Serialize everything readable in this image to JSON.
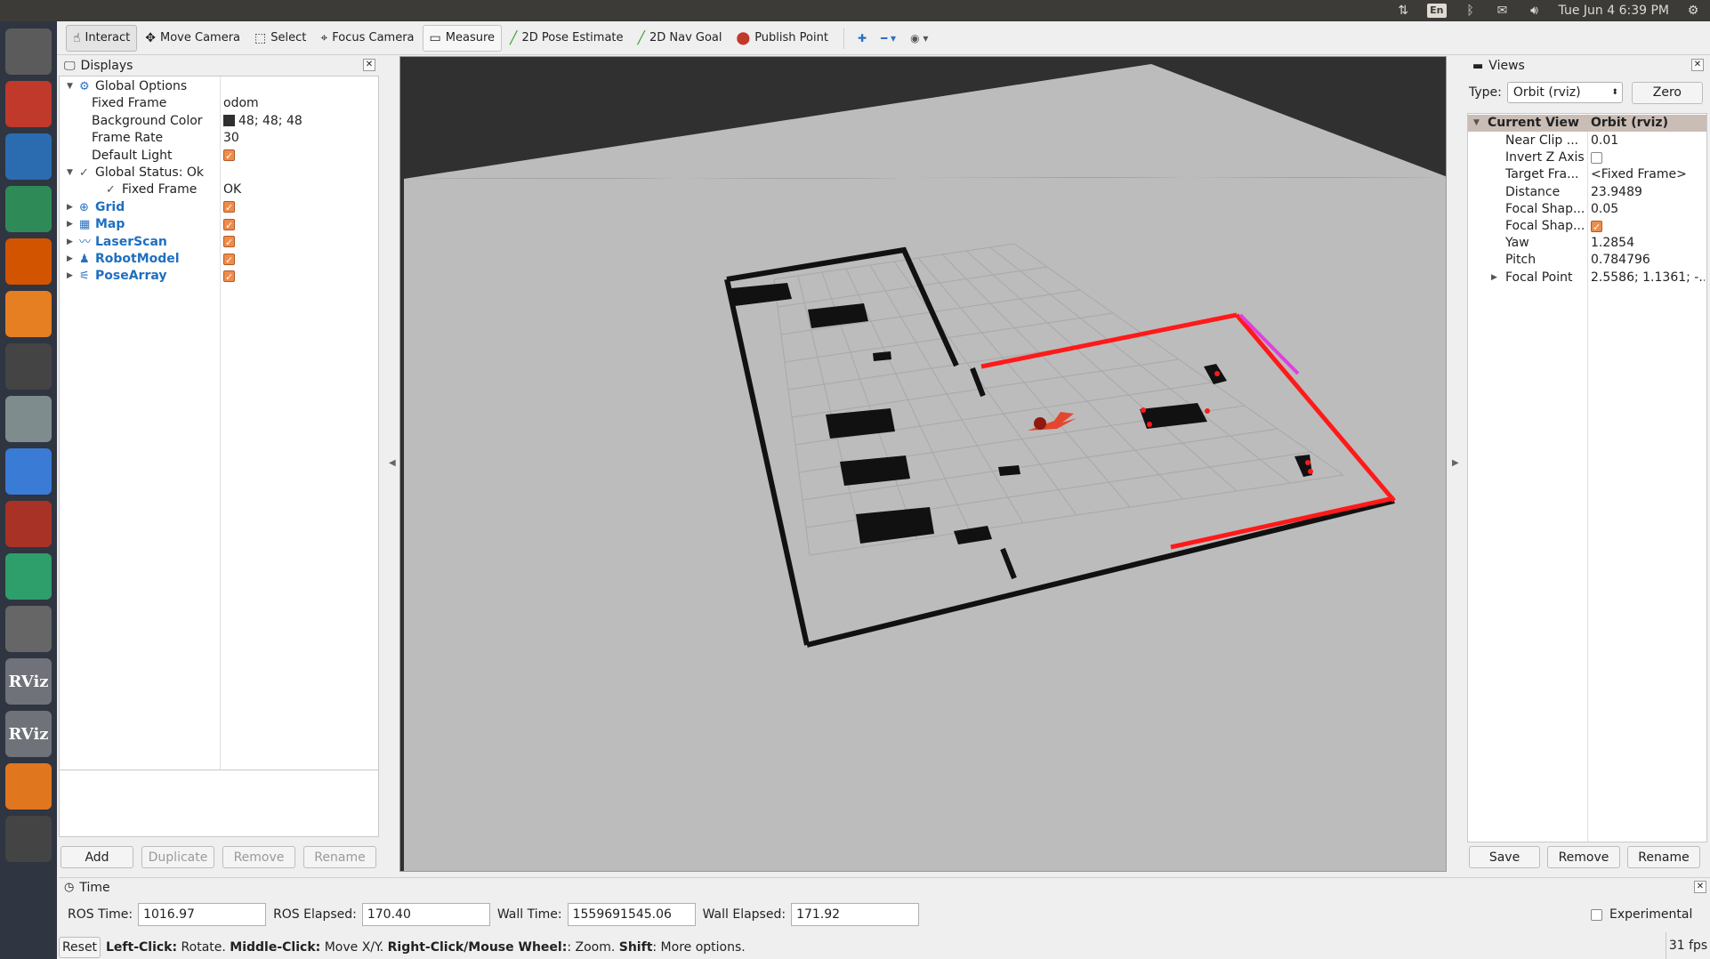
{
  "topbar": {
    "keyboard_layout": "En",
    "clock": "Tue Jun  4  6:39 PM",
    "icons": [
      "network-icon",
      "keyboard-icon",
      "bluetooth-icon",
      "mail-icon",
      "volume-icon",
      "settings-gear-icon"
    ]
  },
  "launcher": {
    "items": [
      {
        "name": "ubuntu-dash-icon",
        "color": "#5b5b5b"
      },
      {
        "name": "files-icon",
        "color": "#c0392b"
      },
      {
        "name": "writer-icon",
        "color": "#2b6cb0"
      },
      {
        "name": "calc-icon",
        "color": "#2e8b57"
      },
      {
        "name": "impress-icon",
        "color": "#d35400"
      },
      {
        "name": "software-center-icon",
        "color": "#e67e22"
      },
      {
        "name": "amazon-icon",
        "color": "#444444"
      },
      {
        "name": "system-settings-icon",
        "color": "#7f8c8d"
      },
      {
        "name": "chrome-icon",
        "color": "#3a7bd5"
      },
      {
        "name": "terminal-red-icon",
        "color": "#a93226"
      },
      {
        "name": "atom-icon",
        "color": "#2e9e6b"
      },
      {
        "name": "calculator-icon",
        "color": "#666666"
      },
      {
        "name": "rviz-icon",
        "color": "#6f7279",
        "text": "RViz"
      },
      {
        "name": "rviz-icon-2",
        "color": "#6f7279",
        "text": "RViz"
      },
      {
        "name": "sublime-icon",
        "color": "#e0771f"
      },
      {
        "name": "trash-icon",
        "color": "#444444"
      }
    ]
  },
  "toolbar": {
    "tools": [
      {
        "label": "Interact",
        "icon": "☝",
        "active": true
      },
      {
        "label": "Move Camera",
        "icon": "✥"
      },
      {
        "label": "Select",
        "icon": "⬚"
      },
      {
        "label": "Focus Camera",
        "icon": "⌖"
      },
      {
        "label": "Measure",
        "icon": "▭",
        "bordered": true
      },
      {
        "label": "2D Pose Estimate",
        "icon": "╱",
        "iconColor": "#2ca02c"
      },
      {
        "label": "2D Nav Goal",
        "icon": "╱",
        "iconColor": "#2ca02c"
      },
      {
        "label": "Publish Point",
        "icon": "⬤",
        "iconColor": "#c0392b"
      }
    ],
    "extra_icons": [
      "add-tool-icon",
      "remove-tool-icon",
      "view-options-icon"
    ]
  },
  "displays": {
    "title": "Displays",
    "rows": [
      {
        "indent": 0,
        "arrow": "▼",
        "icon": "⚙",
        "name": "Global Options",
        "value": ""
      },
      {
        "indent": 1,
        "name": "Fixed Frame",
        "value": "odom"
      },
      {
        "indent": 1,
        "name": "Background Color",
        "value": "48; 48; 48",
        "swatch": true
      },
      {
        "indent": 1,
        "name": "Frame Rate",
        "value": "30"
      },
      {
        "indent": 1,
        "name": "Default Light",
        "checkbox": true
      },
      {
        "indent": 0,
        "arrow": "▼",
        "check": true,
        "name": "Global Status: Ok",
        "value": ""
      },
      {
        "indent": 2,
        "check": true,
        "name": "Fixed Frame",
        "value": "OK"
      },
      {
        "indent": 0,
        "arrow": "▶",
        "icon": "⊕",
        "name": "Grid",
        "blue": true,
        "checkbox": true
      },
      {
        "indent": 0,
        "arrow": "▶",
        "icon": "▦",
        "name": "Map",
        "blue": true,
        "checkbox": true
      },
      {
        "indent": 0,
        "arrow": "▶",
        "icon": "〰",
        "name": "LaserScan",
        "blue": true,
        "checkbox": true
      },
      {
        "indent": 0,
        "arrow": "▶",
        "icon": "♟",
        "name": "RobotModel",
        "blue": true,
        "checkbox": true
      },
      {
        "indent": 0,
        "arrow": "▶",
        "icon": "⚟",
        "name": "PoseArray",
        "blue": true,
        "checkbox": true
      }
    ],
    "buttons": {
      "add": "Add",
      "duplicate": "Duplicate",
      "remove": "Remove",
      "rename": "Rename"
    }
  },
  "views": {
    "title": "Views",
    "type_label": "Type:",
    "type_value": "Orbit (rviz)",
    "zero_label": "Zero",
    "header": {
      "name": "Current View",
      "value": "Orbit (rviz)"
    },
    "rows": [
      {
        "name": "Near Clip ...",
        "value": "0.01"
      },
      {
        "name": "Invert Z Axis",
        "checkbox": false
      },
      {
        "name": "Target Fra...",
        "value": "<Fixed Frame>"
      },
      {
        "name": "Distance",
        "value": "23.9489"
      },
      {
        "name": "Focal Shap...",
        "value": "0.05"
      },
      {
        "name": "Focal Shap...",
        "checkbox": true
      },
      {
        "name": "Yaw",
        "value": "1.2854"
      },
      {
        "name": "Pitch",
        "value": "0.784796"
      },
      {
        "name": "Focal Point",
        "value": "2.5586; 1.1361; -...",
        "arrow": "▶"
      }
    ],
    "buttons": {
      "save": "Save",
      "remove": "Remove",
      "rename": "Rename"
    }
  },
  "time": {
    "title": "Time",
    "ros_time_label": "ROS Time:",
    "ros_time": "1016.97",
    "ros_elapsed_label": "ROS Elapsed:",
    "ros_elapsed": "170.40",
    "wall_time_label": "Wall Time:",
    "wall_time": "1559691545.06",
    "wall_elapsed_label": "Wall Elapsed:",
    "wall_elapsed": "171.92",
    "experimental_label": "Experimental"
  },
  "status": {
    "reset_label": "Reset",
    "hint": [
      {
        "b": "Left-Click:",
        "t": " Rotate. "
      },
      {
        "b": "Middle-Click:",
        "t": " Move X/Y. "
      },
      {
        "b": "Right-Click/Mouse Wheel:",
        "t": ": Zoom. "
      },
      {
        "b": "Shift",
        "t": ": More options."
      }
    ],
    "fps": "31 fps"
  },
  "colors": {
    "viewport_background": "#303030",
    "ground": "#bcbcbc",
    "map_walls": "#111111",
    "laser": "#ff1a1a",
    "laser_far": "#e040e0",
    "accent_checkbox": "#f08c4a"
  }
}
